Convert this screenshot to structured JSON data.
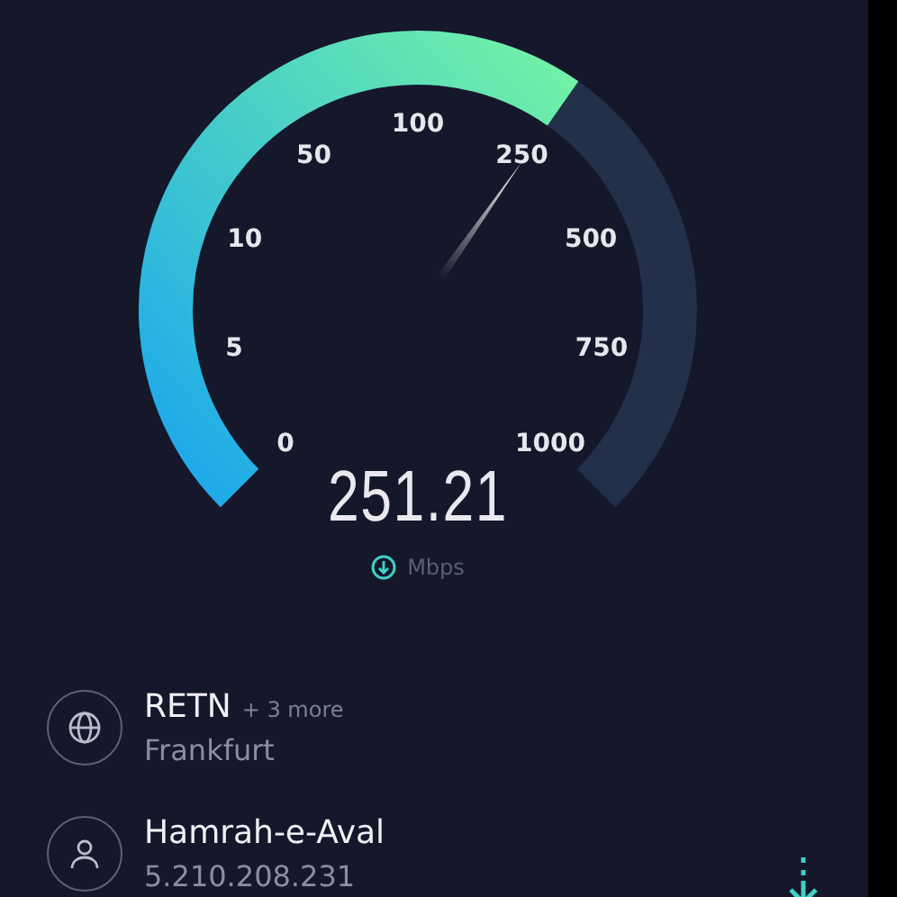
{
  "gauge": {
    "ticks": [
      "0",
      "5",
      "10",
      "50",
      "100",
      "250",
      "500",
      "750",
      "1000"
    ]
  },
  "result": {
    "value": "251.21",
    "unit": "Mbps"
  },
  "servers": [
    {
      "kind": "server",
      "name": "RETN",
      "extra": "+ 3 more",
      "detail": "Frankfurt"
    },
    {
      "kind": "provider",
      "name": "Hamrah-e-Aval",
      "detail": "5.210.208.231"
    }
  ]
}
